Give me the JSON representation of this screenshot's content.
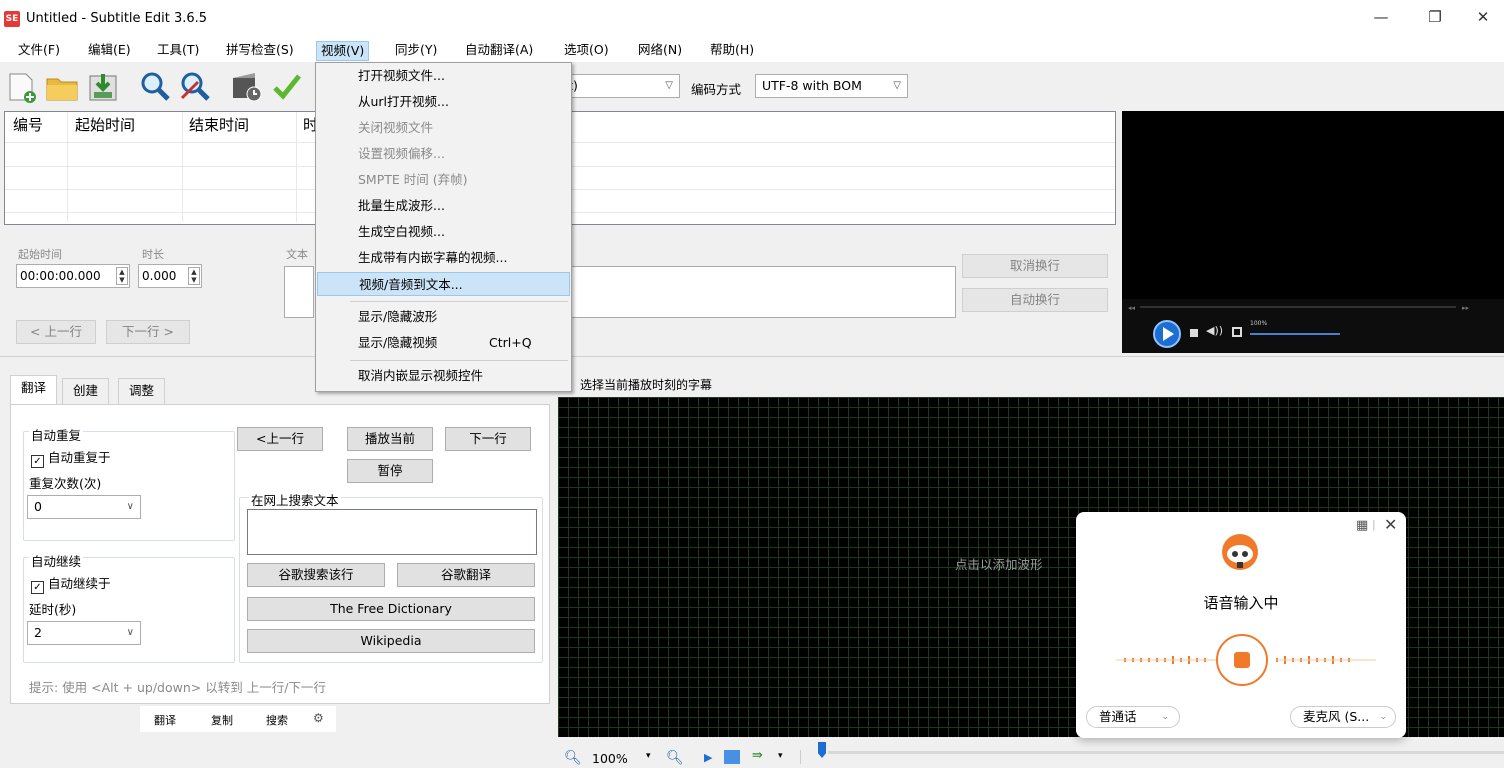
{
  "window": {
    "title": "Untitled - Subtitle Edit 3.6.5",
    "icon_text": "SE",
    "minimize": "—",
    "restore": "❐",
    "close": "✕"
  },
  "menu": [
    "文件(F)",
    "编辑(E)",
    "工具(T)",
    "拼写检查(S)",
    "视频(V)",
    "同步(Y)",
    "自动翻译(A)",
    "选项(O)",
    "网络(N)",
    "帮助(H)"
  ],
  "toolbar": {
    "format_value": "rt)",
    "encoding_label": "编码方式",
    "encoding_value": "UTF-8 with BOM"
  },
  "grid": {
    "headers": [
      "编号",
      "起始时间",
      "结束时间",
      "时"
    ]
  },
  "edit": {
    "start_label": "起始时间",
    "start_value": "00:00:00.000",
    "duration_label": "时长",
    "duration_value": "0.000",
    "text_label": "文本",
    "prev_line": "< 上一行",
    "next_line": "下一行 >",
    "unbreak": "取消换行",
    "auto_break": "自动换行"
  },
  "video_player": {
    "zoom_text": "100%"
  },
  "tabs": [
    "翻译",
    "创建",
    "调整"
  ],
  "translate": {
    "auto_repeat_title": "自动重复",
    "auto_repeat_on": "自动重复于",
    "repeat_count_label": "重复次数(次)",
    "repeat_count_value": "0",
    "auto_continue_title": "自动继续",
    "auto_continue_on": "自动继续于",
    "delay_label": "延时(秒)",
    "delay_value": "2",
    "prev": "<上一行",
    "play_current": "播放当前",
    "next": "下一行",
    "pause": "暂停",
    "search_web_title": "在网上搜索文本",
    "google_search": "谷歌搜索该行",
    "google_translate": "谷歌翻译",
    "free_dictionary": "The Free Dictionary",
    "wikipedia": "Wikipedia",
    "tip": "提示: 使用 <Alt + up/down> 以转到 上一行/下一行"
  },
  "bottom_buttons": [
    "翻译",
    "复制",
    "搜索"
  ],
  "waveform": {
    "select_current": "选择当前播放时刻的字幕",
    "hint": "点击以添加波形",
    "zoom": "100%"
  },
  "video_menu": {
    "items": [
      {
        "label": "打开视频文件...",
        "disabled": false
      },
      {
        "label": "从url打开视频...",
        "disabled": false
      },
      {
        "label": "关闭视频文件",
        "disabled": true
      },
      {
        "label": "设置视频偏移...",
        "disabled": true
      },
      {
        "label": "SMPTE 时间 (弃帧)",
        "disabled": true
      },
      {
        "label": "批量生成波形...",
        "disabled": false
      },
      {
        "label": "生成空白视频...",
        "disabled": false
      },
      {
        "label": "生成带有内嵌字幕的视频...",
        "disabled": false
      },
      {
        "label": "视频/音频到文本...",
        "disabled": false,
        "highlighted": true
      },
      {
        "label": "显示/隐藏波形",
        "disabled": false
      },
      {
        "label": "显示/隐藏视频",
        "disabled": false,
        "shortcut": "Ctrl+Q"
      },
      {
        "label": "取消内嵌显示视频控件",
        "disabled": false
      }
    ]
  },
  "voice_input": {
    "status": "语音输入中",
    "language": "普通话",
    "microphone": "麦克风 (S..."
  },
  "colors": {
    "accent": "#cce4f7",
    "voice_orange": "#f07a2a",
    "video_bg": "#000000"
  }
}
